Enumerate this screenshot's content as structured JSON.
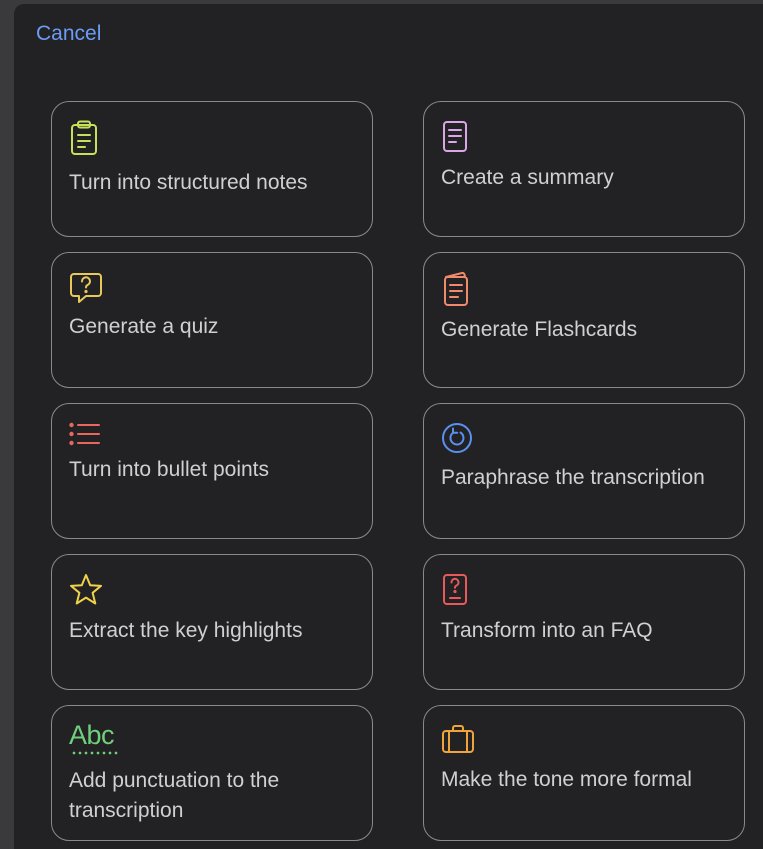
{
  "header": {
    "cancel_label": "Cancel"
  },
  "colors": {
    "cancel": "#6b9cf5",
    "notes_icon": "#c6e05a",
    "summary_icon": "#d9a6e8",
    "quiz_icon": "#e8c85a",
    "flashcards_icon": "#f08a6a",
    "bullets_icon": "#e8685e",
    "paraphrase_icon": "#5b8ff0",
    "highlights_icon": "#f0d24a",
    "faq_icon": "#e85a5a",
    "punctuation_icon": "#6fcf7a",
    "formal_icon": "#f0a53a"
  },
  "actions": [
    {
      "id": "structured-notes",
      "label": "Turn into structured notes",
      "icon": "clipboard-icon"
    },
    {
      "id": "summary",
      "label": "Create a summary",
      "icon": "document-icon"
    },
    {
      "id": "quiz",
      "label": "Generate a quiz",
      "icon": "question-bubble-icon"
    },
    {
      "id": "flashcards",
      "label": "Generate Flashcards",
      "icon": "flashcards-icon"
    },
    {
      "id": "bullet-points",
      "label": "Turn into bullet points",
      "icon": "list-icon"
    },
    {
      "id": "paraphrase",
      "label": "Paraphrase the transcription",
      "icon": "refresh-circle-icon"
    },
    {
      "id": "key-highlights",
      "label": "Extract the key highlights",
      "icon": "star-icon"
    },
    {
      "id": "faq",
      "label": "Transform into an FAQ",
      "icon": "question-doc-icon"
    },
    {
      "id": "punctuation",
      "label": "Add punctuation to the transcription",
      "icon": "abc-spellcheck-icon",
      "icon_text": "Abc"
    },
    {
      "id": "formal-tone",
      "label": "Make the tone more formal",
      "icon": "briefcase-icon"
    }
  ]
}
